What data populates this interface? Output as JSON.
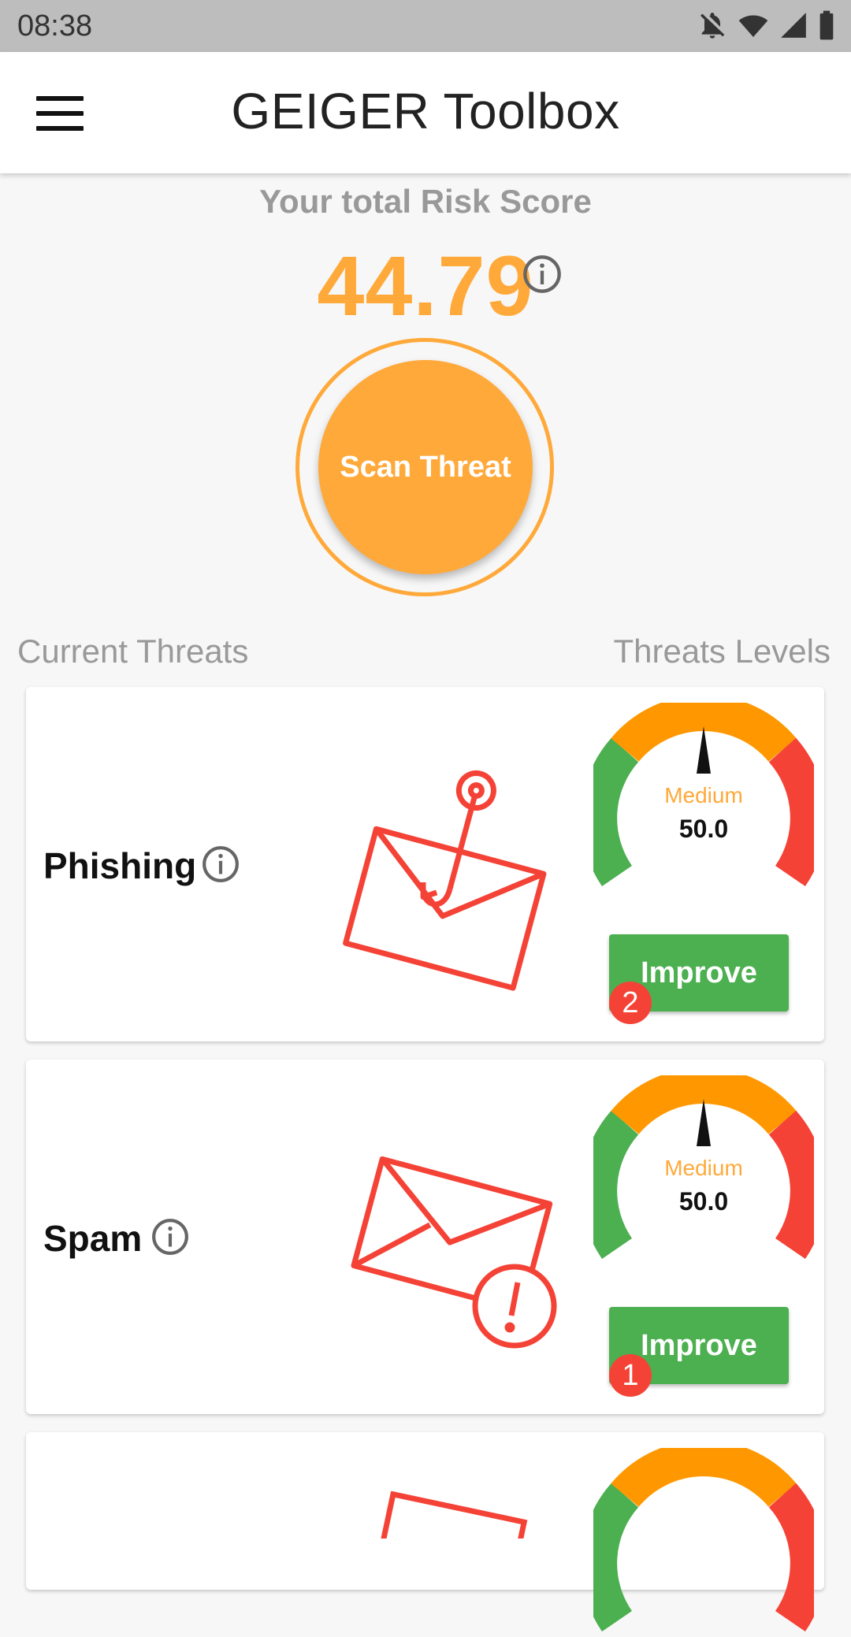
{
  "status_bar": {
    "time": "08:38"
  },
  "app_bar": {
    "title": "GEIGER Toolbox"
  },
  "risk": {
    "label": "Your total Risk Score",
    "score": "44.79",
    "scan_button": "Scan Threat"
  },
  "sections": {
    "current": "Current Threats",
    "levels": "Threats Levels"
  },
  "threats": [
    {
      "name": "Phishing",
      "level": "Medium",
      "value": "50.0",
      "improve_label": "Improve",
      "badge": "2",
      "icon": "phishing-envelope-icon"
    },
    {
      "name": "Spam",
      "level": "Medium",
      "value": "50.0",
      "improve_label": "Improve",
      "badge": "1",
      "icon": "spam-envelope-icon"
    }
  ],
  "colors": {
    "accent": "#ffa93a",
    "gauge_low": "#4caf50",
    "gauge_mid": "#ff9800",
    "gauge_high": "#f44336",
    "improve": "#4caf50",
    "badge": "#f44336"
  }
}
